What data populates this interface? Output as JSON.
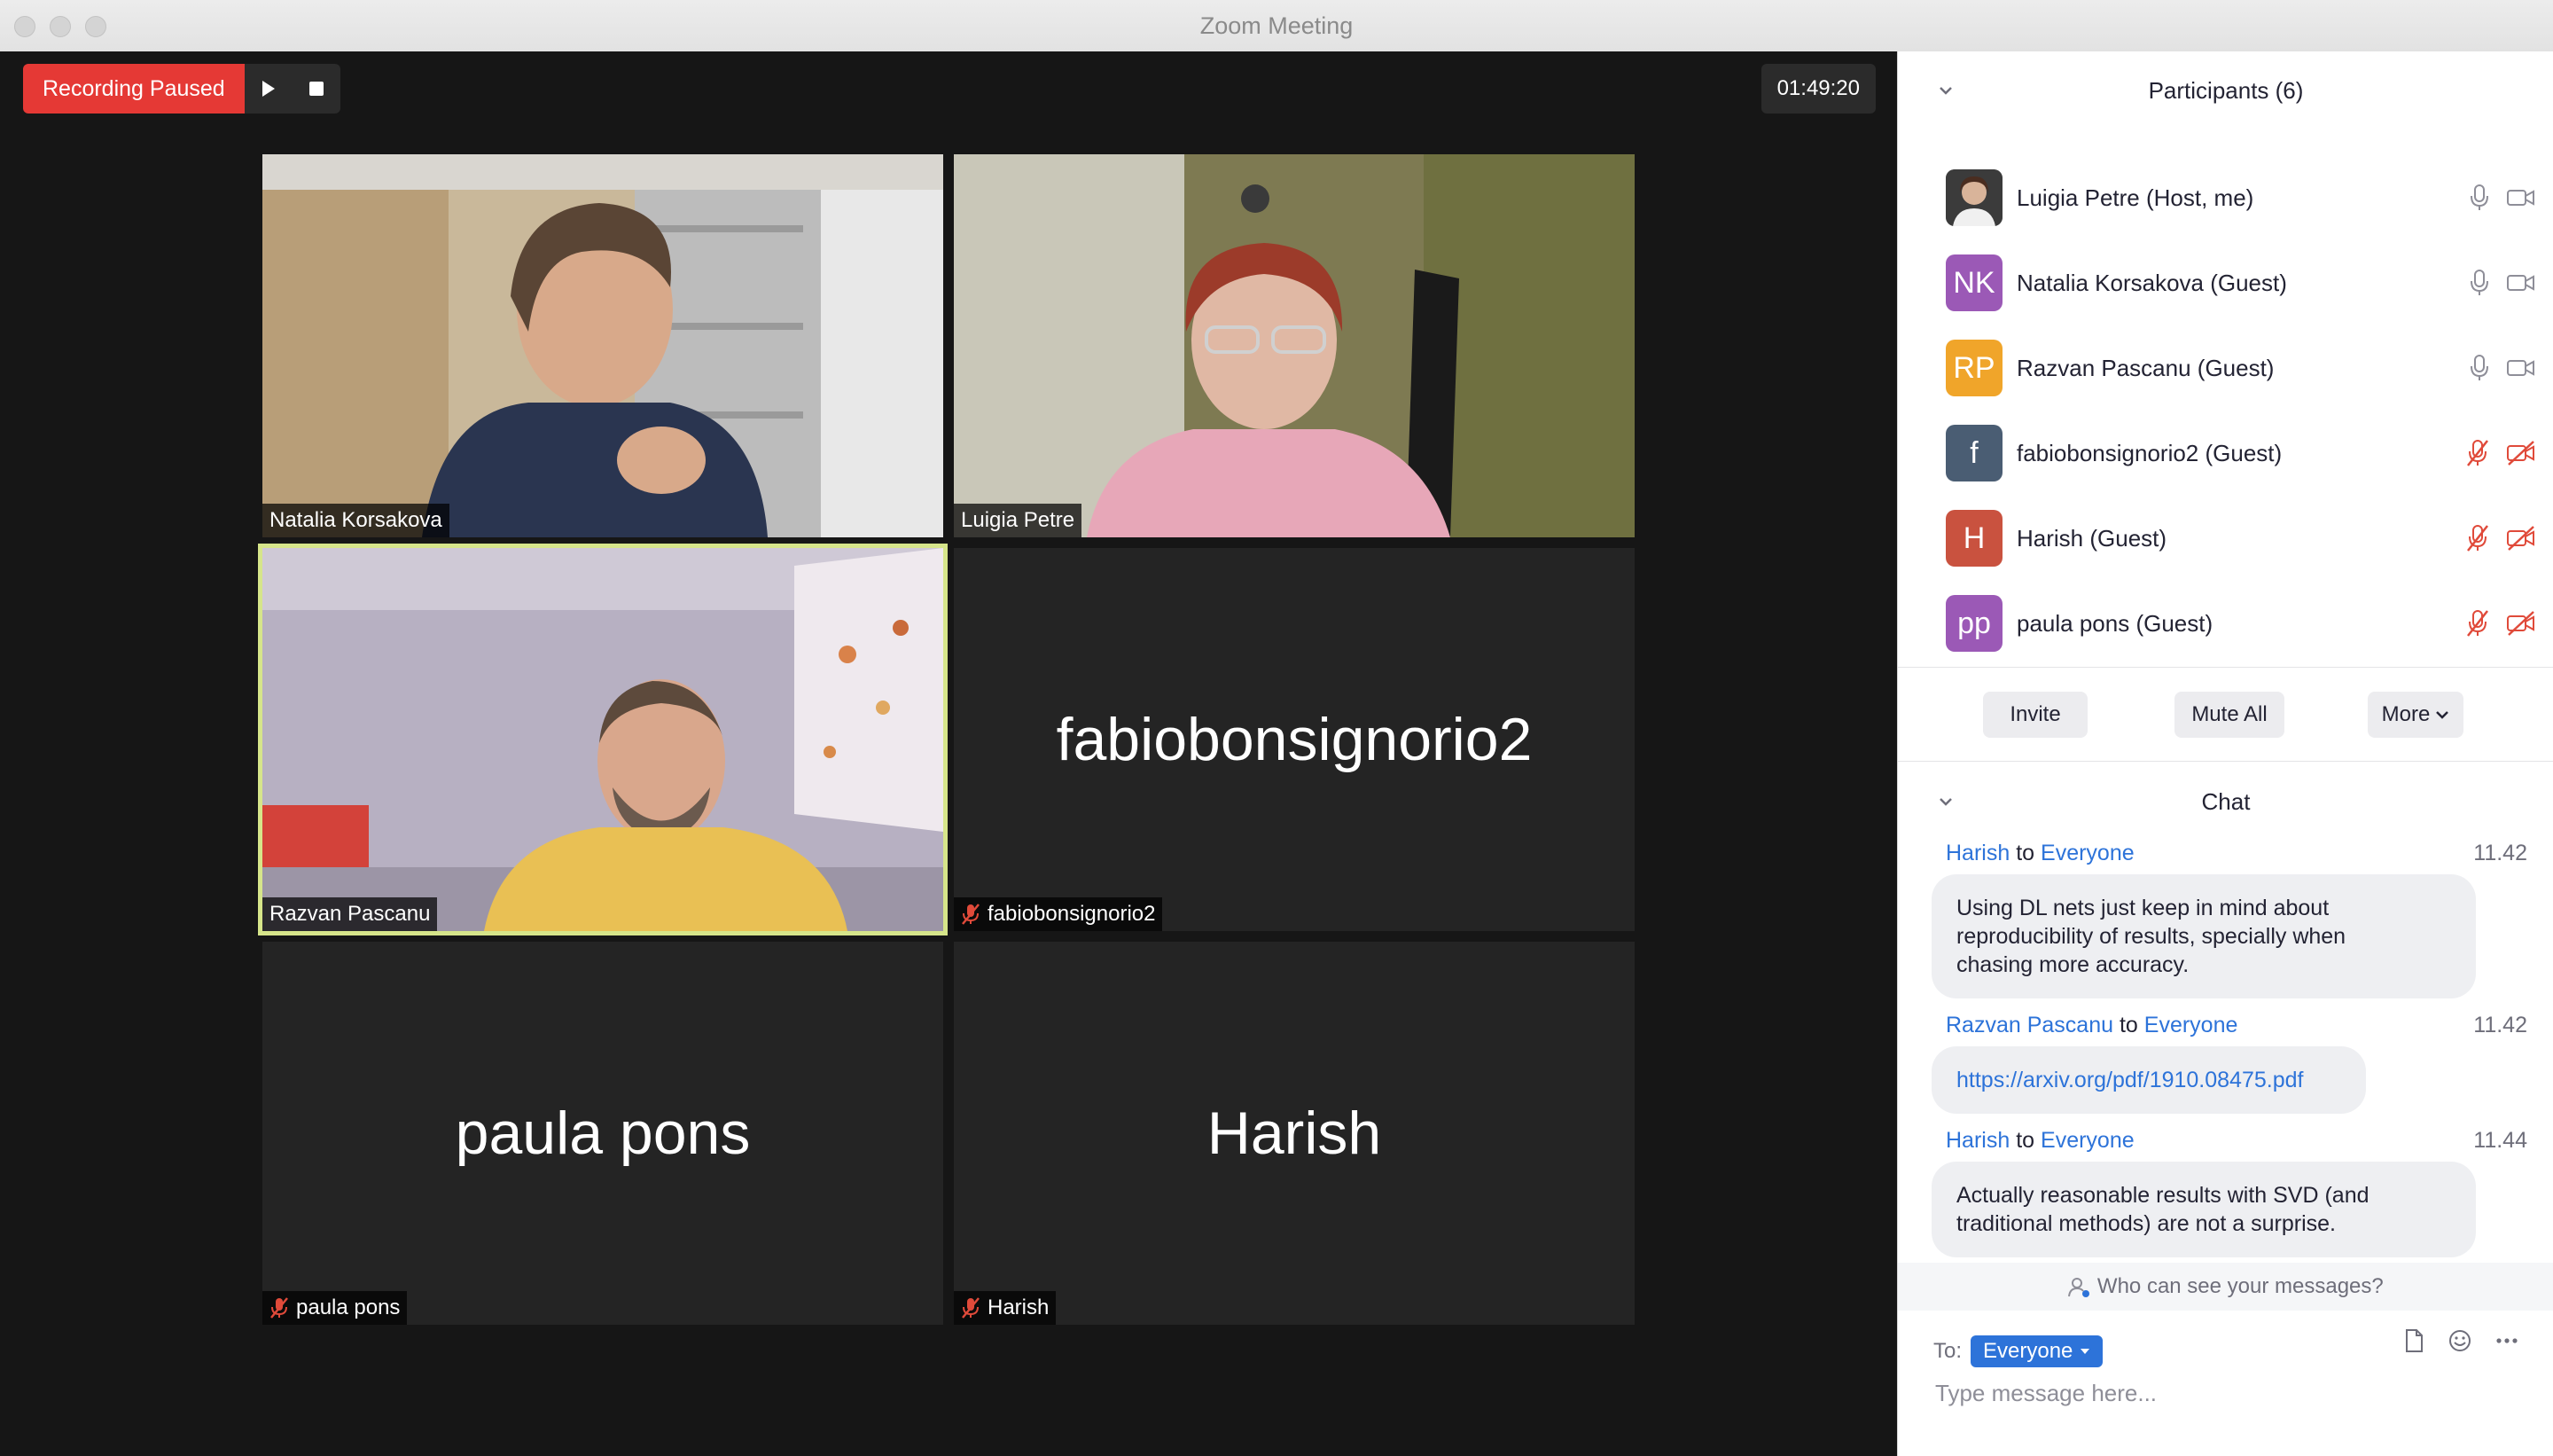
{
  "window": {
    "title": "Zoom Meeting"
  },
  "recording": {
    "status_label": "Recording Paused",
    "timer": "01:49:20"
  },
  "tiles": [
    {
      "name": "Natalia Korsakova",
      "video": true,
      "muted": false,
      "active": false
    },
    {
      "name": "Luigia Petre",
      "video": true,
      "muted": false,
      "active": false
    },
    {
      "name": "Razvan Pascanu",
      "video": true,
      "muted": false,
      "active": true
    },
    {
      "name": "fabiobonsignorio2",
      "video": false,
      "muted": true,
      "active": false
    },
    {
      "name": "paula pons",
      "video": false,
      "muted": true,
      "active": false
    },
    {
      "name": "Harish",
      "video": false,
      "muted": true,
      "active": false
    }
  ],
  "participants": {
    "header": "Participants (6)",
    "list": [
      {
        "name": "Luigia Petre (Host, me)",
        "initials": "",
        "color": "#6d6d6d",
        "mic": "on",
        "video": "on"
      },
      {
        "name": "Natalia Korsakova (Guest)",
        "initials": "NK",
        "color": "#9b59b6",
        "mic": "on",
        "video": "on"
      },
      {
        "name": "Razvan Pascanu (Guest)",
        "initials": "RP",
        "color": "#f0a52a",
        "mic": "on",
        "video": "on"
      },
      {
        "name": "fabiobonsignorio2 (Guest)",
        "initials": "f",
        "color": "#4a5d73",
        "mic": "off",
        "video": "off"
      },
      {
        "name": "Harish (Guest)",
        "initials": "H",
        "color": "#c9523f",
        "mic": "off",
        "video": "off"
      },
      {
        "name": "paula pons (Guest)",
        "initials": "pp",
        "color": "#9b59b6",
        "mic": "off",
        "video": "off"
      }
    ],
    "buttons": {
      "invite": "Invite",
      "mute_all": "Mute All",
      "more": "More"
    }
  },
  "chat": {
    "header": "Chat",
    "messages": [
      {
        "from": "Harish",
        "to_word": "to",
        "to": "Everyone",
        "time": "11.42",
        "lines": [
          "Using DL nets just keep in mind about",
          "reproducibility of results, specially when",
          "chasing more accuracy."
        ]
      },
      {
        "from": "Razvan Pascanu",
        "to_word": "to",
        "to": "Everyone",
        "time": "11.42",
        "link": "https://arxiv.org/pdf/1910.08475.pdf"
      },
      {
        "from": "Harish",
        "to_word": "to",
        "to": "Everyone",
        "time": "11.44",
        "lines": [
          "Actually reasonable results with SVD (and",
          "traditional methods) are not a surprise."
        ]
      }
    ],
    "who_can_see": "Who can see your messages?",
    "to_label": "To:",
    "recipient": "Everyone",
    "placeholder": "Type message here..."
  },
  "colors": {
    "recording_red": "#e53935",
    "link_blue": "#2d73d9",
    "active_speaker": "#d6e58a",
    "muted_red": "#e04a3a"
  }
}
